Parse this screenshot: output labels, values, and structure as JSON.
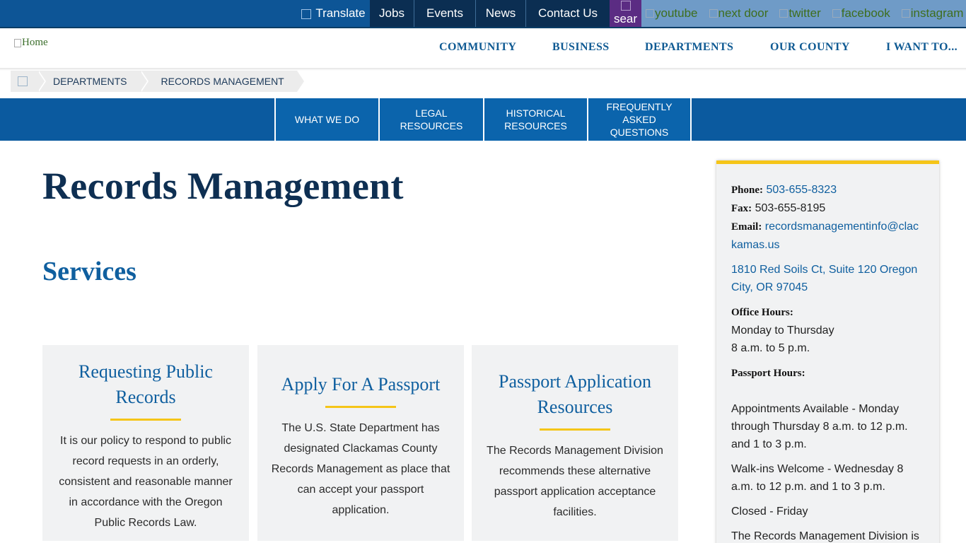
{
  "topbar": {
    "translate": "Translate",
    "links": [
      "Jobs",
      "Events",
      "News",
      "Contact Us"
    ],
    "search_alt": "sear",
    "social": [
      "youtube",
      "next door",
      "twitter",
      "facebook",
      "instagram"
    ]
  },
  "logo_alt": "Home",
  "nav": [
    "COMMUNITY",
    "BUSINESS",
    "DEPARTMENTS",
    "OUR COUNTY",
    "I WANT TO..."
  ],
  "breadcrumb": [
    "DEPARTMENTS",
    "RECORDS MANAGEMENT"
  ],
  "subnav": [
    {
      "l1": "WHAT WE DO",
      "l2": "",
      "l3": ""
    },
    {
      "l1": "LEGAL",
      "l2": "RESOURCES",
      "l3": ""
    },
    {
      "l1": "HISTORICAL",
      "l2": "RESOURCES",
      "l3": ""
    },
    {
      "l1": "FREQUENTLY",
      "l2": "ASKED",
      "l3": "QUESTIONS"
    }
  ],
  "page_title": "Records Management",
  "services_heading": "Services",
  "cards": [
    {
      "title_lines": [
        "Requesting Public",
        "Records"
      ],
      "text_lines": [
        "It is our policy to respond to public",
        "record requests in an orderly,",
        "consistent and reasonable manner",
        "in accordance with the Oregon",
        "Public Records Law."
      ]
    },
    {
      "title_lines": [
        "Apply For A Passport"
      ],
      "text_lines": [
        "The U.S. State Department has",
        "designated Clackamas County",
        "Records Management as place that",
        "can accept your passport",
        "application."
      ]
    },
    {
      "title_lines": [
        "Passport Application",
        "Resources"
      ],
      "text_lines": [
        "The Records Management Division",
        "recommends these alternative",
        "passport application acceptance",
        "facilities."
      ]
    }
  ],
  "sidebar": {
    "phone_label": "Phone:",
    "phone": "503-655-8323",
    "fax_label": "Fax:",
    "fax": "503-655-8195",
    "email_label": "Email:",
    "email_line1": "recordsmanagementinfo@clac",
    "email_line2": "kamas.us",
    "address_line1": "1810 Red Soils Ct, Suite 120 Oregon",
    "address_line2": "City, OR 97045",
    "office_hours_label": "Office Hours:",
    "office_hours_line1": "Monday to Thursday",
    "office_hours_line2": "8 a.m. to 5 p.m.",
    "passport_hours_label": "Passport Hours:",
    "appt_line1": "Appointments Available - Monday",
    "appt_line2": "through Thursday 8 a.m. to 12 p.m.",
    "appt_line3": "and 1 to 3 p.m.",
    "walkin_line1": "Walk-ins Welcome - Wednesday 8",
    "walkin_line2": "a.m. to 12 p.m. and 1 to 3 p.m.",
    "closed": "Closed - Friday",
    "division_line": "The Records Management Division is"
  },
  "colors": {
    "primary_blue": "#0b64ac",
    "dark_navy": "#0e2f52",
    "accent_yellow": "#f5c518",
    "search_purple": "#5b2c83"
  }
}
